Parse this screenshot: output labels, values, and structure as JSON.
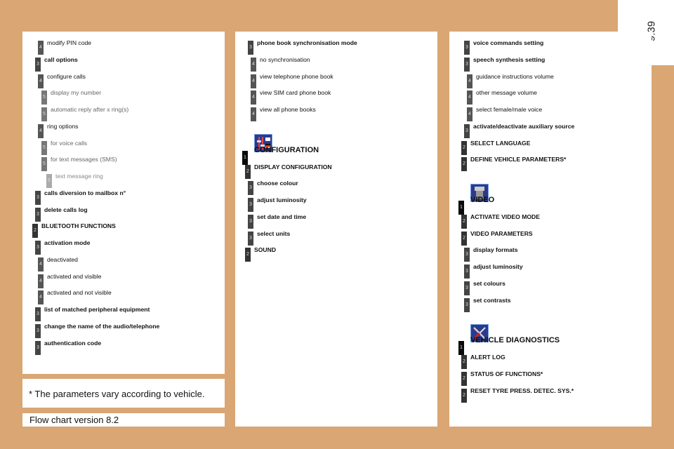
{
  "page_number": "9.39",
  "footnote": "* The parameters vary according to vehicle.",
  "version": "Flow chart version 8.2",
  "badge_colors": {
    "1": "#0a0a0a",
    "2": "#333333",
    "3": "#444444",
    "4": "#555555",
    "5": "#777777",
    "6": "#aaaaaa"
  },
  "columns": [
    {
      "items": [
        {
          "level": 4,
          "label": "modify PIN code"
        },
        {
          "level": 3,
          "label": "call options"
        },
        {
          "level": 4,
          "label": "configure calls"
        },
        {
          "level": 5,
          "label": "display my number"
        },
        {
          "level": 5,
          "label": "automatic reply after x ring(s)"
        },
        {
          "level": 4,
          "label": "ring options"
        },
        {
          "level": 5,
          "label": "for voice calls"
        },
        {
          "level": 5,
          "label": "for text messages (SMS)"
        },
        {
          "level": 6,
          "label": "text message ring"
        },
        {
          "level": 3,
          "label": "calls diversion to mailbox n°"
        },
        {
          "level": 3,
          "label": "delete calls log"
        },
        {
          "level": 2,
          "label": "BLUETOOTH FUNCTIONS"
        },
        {
          "level": 3,
          "label": "activation mode"
        },
        {
          "level": 4,
          "label": "deactivated"
        },
        {
          "level": 4,
          "label": "activated and visible"
        },
        {
          "level": 4,
          "label": "activated and not visible"
        },
        {
          "level": 3,
          "label": "list of matched peripheral equipment"
        },
        {
          "level": 3,
          "label": "change the name of the audio/telephone"
        },
        {
          "level": 3,
          "label": "authentication code"
        }
      ]
    },
    {
      "items": [
        {
          "level": 3,
          "label": "phone book synchronisation mode"
        },
        {
          "level": 4,
          "label": "no synchronisation"
        },
        {
          "level": 4,
          "label": "view telephone phone book"
        },
        {
          "level": 4,
          "label": "view SIM card phone book"
        },
        {
          "level": 4,
          "label": "view all phone books"
        },
        {
          "icon": "configuration-icon"
        },
        {
          "level": 1,
          "label": "CONFIGURATION"
        },
        {
          "level": 2,
          "label": "DISPLAY CONFIGURATION"
        },
        {
          "level": 3,
          "label": "choose colour"
        },
        {
          "level": 3,
          "label": "adjust luminosity"
        },
        {
          "level": 3,
          "label": "set date and time"
        },
        {
          "level": 3,
          "label": "select units"
        },
        {
          "level": 2,
          "label": "SOUND"
        }
      ]
    },
    {
      "items": [
        {
          "level": 3,
          "label": "voice commands setting"
        },
        {
          "level": 3,
          "label": "speech synthesis setting"
        },
        {
          "level": 4,
          "label": "guidance instructions volume"
        },
        {
          "level": 4,
          "label": "other message volume"
        },
        {
          "level": 4,
          "label": "select female/male voice"
        },
        {
          "level": 3,
          "label": "activate/deactivate auxiliary source"
        },
        {
          "level": 2,
          "label": "SELECT LANGUAGE"
        },
        {
          "level": 2,
          "label": "DEFINE VEHICLE PARAMETERS*"
        },
        {
          "icon": "video-icon"
        },
        {
          "level": 1,
          "label": "VIDEO"
        },
        {
          "level": 2,
          "label": "ACTIVATE VIDEO MODE"
        },
        {
          "level": 2,
          "label": "VIDEO PARAMETERS"
        },
        {
          "level": 3,
          "label": "display formats"
        },
        {
          "level": 3,
          "label": "adjust luminosity"
        },
        {
          "level": 3,
          "label": "set colours"
        },
        {
          "level": 3,
          "label": "set contrasts"
        },
        {
          "icon": "vehicle-diagnostics-icon"
        },
        {
          "level": 1,
          "label": "VEHICLE DIAGNOSTICS"
        },
        {
          "level": 2,
          "label": "ALERT LOG"
        },
        {
          "level": 2,
          "label": "STATUS OF FUNCTIONS*"
        },
        {
          "level": 2,
          "label": "RESET TYRE PRESS. DETEC. SYS.*"
        }
      ]
    }
  ]
}
